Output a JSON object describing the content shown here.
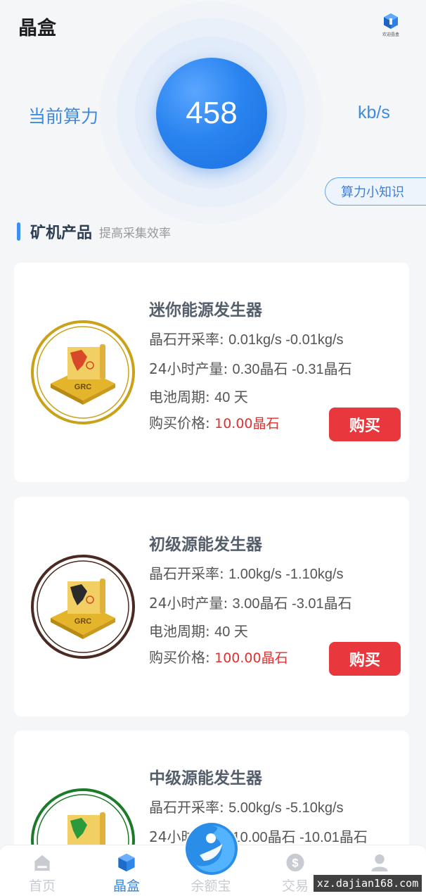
{
  "header": {
    "title": "晶盒",
    "brand_logo_text": "欢迎晶盒"
  },
  "hashrate": {
    "label": "当前算力",
    "value": "458",
    "unit": "kb/s",
    "knowledge_button": "算力小知识"
  },
  "section": {
    "title": "矿机产品",
    "subtitle": "提高采集效率"
  },
  "products": [
    {
      "name": "迷你能源发生器",
      "rate_label": "晶石开采率: ",
      "rate_value": "0.01kg/s -0.01kg/s",
      "output_label": "24小时产量: ",
      "output_value": "0.30晶石 -0.31晶石",
      "battery_label": "电池周期: ",
      "battery_value": "40 天",
      "price_label": "购买价格: ",
      "price_value": "10.00晶石",
      "buy_label": "购买",
      "logo_text": "GRC",
      "ring_color": "#c9a21a",
      "map_color": "#d9472b"
    },
    {
      "name": "初级源能发生器",
      "rate_label": "晶石开采率: ",
      "rate_value": "1.00kg/s -1.10kg/s",
      "output_label": "24小时产量: ",
      "output_value": "3.00晶石 -3.01晶石",
      "battery_label": "电池周期: ",
      "battery_value": "40 天",
      "price_label": "购买价格: ",
      "price_value": "100.00晶石",
      "buy_label": "购买",
      "logo_text": "GRC",
      "ring_color": "#4a2a22",
      "map_color": "#2a2a2a"
    },
    {
      "name": "中级源能发生器",
      "rate_label": "晶石开采率: ",
      "rate_value": "5.00kg/s -5.10kg/s",
      "output_label": "24小时产量: ",
      "output_value": "10.00晶石 -10.01晶石",
      "logo_text": "GRC",
      "ring_color": "#1d7a2a",
      "map_color": "#2a9a3a"
    }
  ],
  "tabbar": {
    "items": [
      {
        "label": "首页",
        "icon": "home-icon"
      },
      {
        "label": "晶盒",
        "icon": "box-icon"
      },
      {
        "label": "余额宝",
        "icon": "balance-icon"
      },
      {
        "label": "交易",
        "icon": "dollar-icon"
      },
      {
        "label": "我的",
        "icon": "user-icon"
      }
    ],
    "active_index": 1
  },
  "watermark": "xz.dajian168.com",
  "colors": {
    "accent": "#2f86e6",
    "buy": "#e8383d",
    "price": "#e03030"
  }
}
